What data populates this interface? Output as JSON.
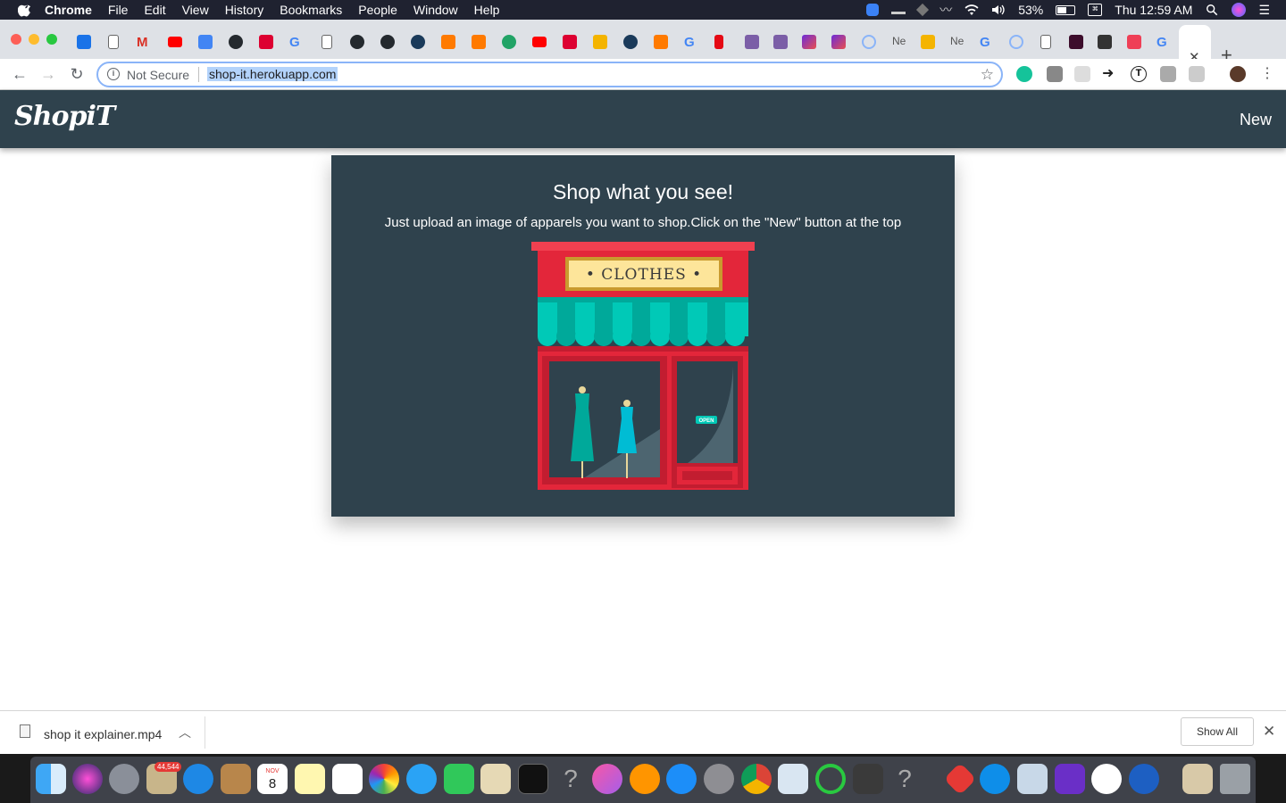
{
  "menubar": {
    "app_name": "Chrome",
    "items": [
      "File",
      "Edit",
      "View",
      "History",
      "Bookmarks",
      "People",
      "Window",
      "Help"
    ],
    "battery": "53%",
    "clock": "Thu 12:59 AM"
  },
  "tabs": {
    "truncated_label": "Ne",
    "close_glyph": "✕",
    "new_tab_glyph": "+"
  },
  "toolbar": {
    "security_label": "Not Secure",
    "url": "shop-it.herokuapp.com"
  },
  "app": {
    "logo": "ShopiT",
    "new_button": "New"
  },
  "hero": {
    "title": "Shop what you see!",
    "subtitle": "Just upload an image of apparels you want to shop.Click on the \"New\" button at the top",
    "sign_text": "• CLOTHES •",
    "open_sign": "OPEN"
  },
  "download_bar": {
    "filename": "shop it explainer.mp4",
    "show_all": "Show All"
  },
  "dock": {
    "mail_badge": "44,544",
    "calendar_month": "NOV",
    "calendar_day": "8"
  },
  "colors": {
    "header_bg": "#2f424d",
    "store_red": "#e3263a",
    "awning_teal": "#00c9b7"
  }
}
